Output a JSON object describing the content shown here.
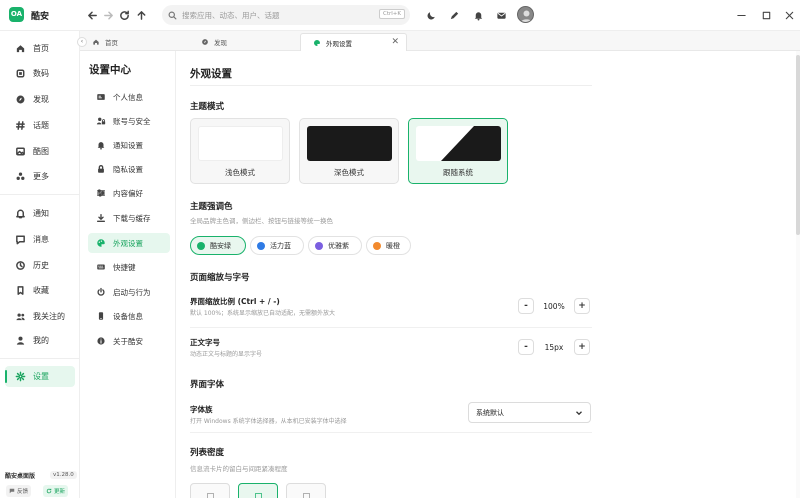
{
  "app": {
    "logo_text": "OA",
    "name": "酷安"
  },
  "search": {
    "placeholder": "搜索应用、动态、用户、话题",
    "shortcut": "Ctrl+K"
  },
  "sidebar": {
    "items": [
      {
        "label": "首页",
        "icon": "home-icon"
      },
      {
        "label": "数码",
        "icon": "chip-icon"
      },
      {
        "label": "发现",
        "icon": "compass-icon"
      },
      {
        "label": "话题",
        "icon": "hash-icon"
      },
      {
        "label": "酷图",
        "icon": "image-icon"
      },
      {
        "label": "更多",
        "icon": "more-icon"
      },
      {
        "label": "通知",
        "icon": "bell-icon"
      },
      {
        "label": "消息",
        "icon": "message-icon"
      },
      {
        "label": "历史",
        "icon": "history-icon"
      },
      {
        "label": "收藏",
        "icon": "bookmark-icon"
      },
      {
        "label": "我关注的",
        "icon": "users-icon"
      },
      {
        "label": "我的",
        "icon": "user-icon"
      },
      {
        "label": "设置",
        "icon": "settings-icon"
      }
    ],
    "active": "设置",
    "footer": {
      "name": "酷安桌面版",
      "version": "v1.28.0",
      "feedback": "反馈",
      "update": "更新"
    }
  },
  "tabs": [
    {
      "label": "首页",
      "icon": "home-icon"
    },
    {
      "label": "发现",
      "icon": "compass-icon"
    },
    {
      "label": "外观设置",
      "icon": "palette-icon",
      "active": true
    }
  ],
  "settings_menu": {
    "title": "设置中心",
    "items": [
      {
        "label": "个人信息",
        "icon": "id-card-icon"
      },
      {
        "label": "账号与安全",
        "icon": "user-lock-icon"
      },
      {
        "label": "通知设置",
        "icon": "bell-icon"
      },
      {
        "label": "隐私设置",
        "icon": "lock-icon"
      },
      {
        "label": "内容偏好",
        "icon": "sliders-icon"
      },
      {
        "label": "下载与缓存",
        "icon": "download-icon"
      },
      {
        "label": "外观设置",
        "icon": "palette-icon",
        "active": true
      },
      {
        "label": "快捷键",
        "icon": "keyboard-icon"
      },
      {
        "label": "启动与行为",
        "icon": "power-icon"
      },
      {
        "label": "设备信息",
        "icon": "device-icon"
      },
      {
        "label": "关于酷安",
        "icon": "info-icon"
      }
    ]
  },
  "content": {
    "title": "外观设置",
    "theme": {
      "title": "主题模式",
      "options": [
        {
          "label": "浅色模式"
        },
        {
          "label": "深色模式"
        },
        {
          "label": "跟随系统",
          "selected": true
        }
      ]
    },
    "accent": {
      "title": "主题强调色",
      "desc": "全局品牌主色调，侧边栏、按钮与链接等统一换色",
      "options": [
        {
          "label": "酷安绿",
          "color": "#19b26b",
          "selected": true
        },
        {
          "label": "活力蓝",
          "color": "#2f7be5"
        },
        {
          "label": "优雅紫",
          "color": "#7b5fe0"
        },
        {
          "label": "暖橙",
          "color": "#f28a2e"
        }
      ]
    },
    "zoom_section": {
      "title": "页面缩放与字号",
      "zoom": {
        "label": "界面缩放比例 (Ctrl + / -)",
        "desc": "默认 100%；系统显示缩放已自动适配，无需额外放大",
        "value": "100%",
        "minus": "-",
        "plus": "+"
      },
      "font_size": {
        "label": "正文字号",
        "desc": "动态正文与标题的显示字号",
        "value": "15px",
        "minus": "-",
        "plus": "+"
      }
    },
    "font_section": {
      "title": "界面字体",
      "family_label": "字体族",
      "family_desc": "打开 Windows 系统字体选择器，从本机已安装字体中选择",
      "family_value": "系统默认"
    },
    "density": {
      "title": "列表密度",
      "desc": "信息流卡片的留白与间距紧凑程度",
      "selected_index": 1
    }
  },
  "colors": {
    "accent": "#19b26b",
    "accent_bg": "#e6f7ee"
  }
}
